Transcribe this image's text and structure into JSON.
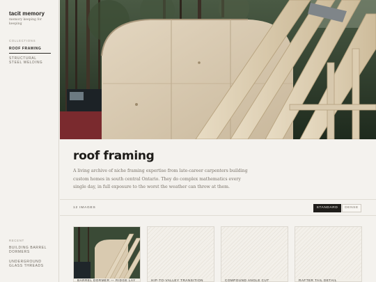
{
  "app": {
    "brand": "tacit memory",
    "tagline": "memory keeping for keeping"
  },
  "sidebar": {
    "collections_label": "COLLECTIONS",
    "collections": [
      {
        "label": "ROOF FRAMING",
        "active": true
      },
      {
        "label": "STRUCTURAL STEEL WELDING",
        "active": false
      }
    ],
    "recent_label": "RECENT",
    "recent": [
      {
        "label": "BUILDING BARREL DORMERS"
      },
      {
        "label": "UNDERGROUND GLASS THREADS"
      }
    ]
  },
  "hero": {
    "icon": "roof-framing-photo"
  },
  "page": {
    "title": "roof framing",
    "description": "A living archive of niche framing expertise from late-career carpenters building custom homes in south central Ontario. They do complex mathematics every single day, in full exposure to the worst the weather can throw at them."
  },
  "toolbar": {
    "count": "12 IMAGES",
    "view_options": [
      "STANDARD",
      "DENSE"
    ],
    "selected_view": "STANDARD"
  },
  "cards": [
    {
      "label": "BARREL DORMER — RIDGE LAY",
      "has_photo": true
    },
    {
      "label": "HIP-TO-VALLEY TRANSITION",
      "has_photo": false
    },
    {
      "label": "COMPOUND ANGLE CUT",
      "has_photo": false
    },
    {
      "label": "RAFTER TAIL DETAIL",
      "has_photo": false
    }
  ],
  "colors": {
    "background": "#f4f2ee",
    "text": "#1f1d1a",
    "muted": "#7a7369",
    "active_button": "#1f1d1a"
  }
}
